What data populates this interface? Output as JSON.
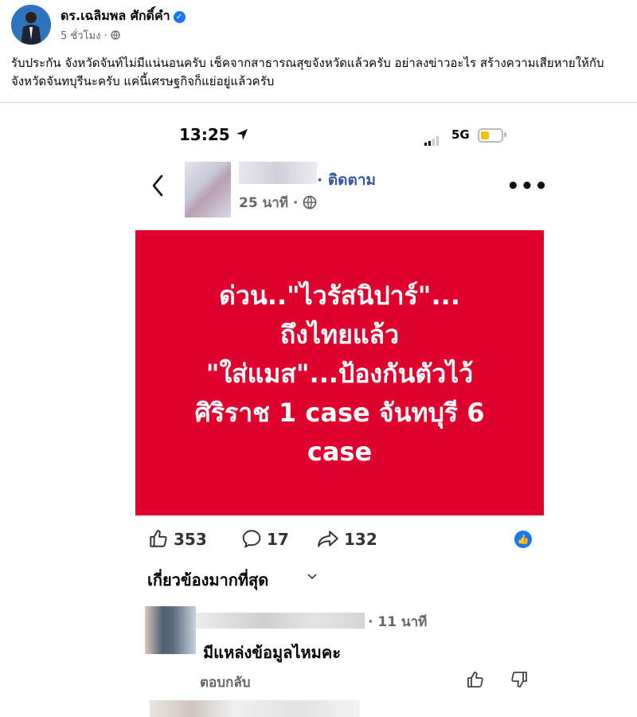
{
  "post": {
    "author": "ดร.เฉลิมพล ศักดิ์คำ",
    "time": "5 ชั่วโมง",
    "caption": "รับประกัน  จังหวัดจันท์ไม่มีแน่นอนครับ  เช็คจากสาธารณสุขจังหวัดแล้วครับ อย่าลงข่าวอะไร  สร้างความเสียหายให้กับ จังหวัดจันทบุรีนะครับ  แค่นี้เศรษฐกิจก็แย่อยู่แล้วครับ"
  },
  "screenshot": {
    "status_time": "13:25",
    "network": "5G",
    "follow": "ติดตาม",
    "source_time": "25 นาที",
    "banner_lines": [
      "ด่วน..\"ไวรัสนิปาร์\"...",
      "ถึงไทยแล้ว",
      "\"ใส่แมส\"...ป้องกันตัวไว้",
      "ศิริราช 1 case จันทบุรี 6",
      "case"
    ],
    "banner_color": "#e0002d",
    "likes": "353",
    "comments": "17",
    "shares": "132",
    "sort_label": "เกี่ยวข้องมากที่สุด",
    "comment": {
      "time": "11 นาที",
      "text": "มีแหล่งข้อมูลไหมคะ",
      "reply": "ตอบกลับ"
    }
  }
}
